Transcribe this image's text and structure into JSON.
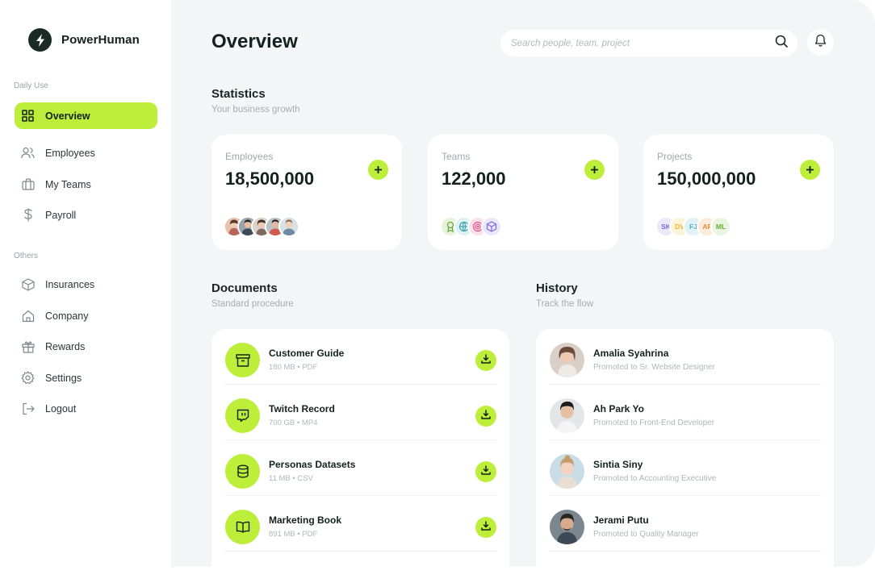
{
  "brand": {
    "name": "PowerHuman"
  },
  "sidebar": {
    "daily_label": "Daily Use",
    "others_label": "Others",
    "daily_items": [
      {
        "label": "Overview",
        "icon": "grid-icon",
        "active": true
      },
      {
        "label": "Employees",
        "icon": "users-icon"
      },
      {
        "label": "My Teams",
        "icon": "briefcase-icon"
      },
      {
        "label": "Payroll",
        "icon": "dollar-icon"
      }
    ],
    "other_items": [
      {
        "label": "Insurances",
        "icon": "box-icon"
      },
      {
        "label": "Company",
        "icon": "home-icon"
      },
      {
        "label": "Rewards",
        "icon": "gift-icon"
      },
      {
        "label": "Settings",
        "icon": "gear-icon"
      },
      {
        "label": "Logout",
        "icon": "logout-icon"
      }
    ]
  },
  "header": {
    "title": "Overview",
    "search_placeholder": "Search people, team, project"
  },
  "statistics": {
    "title": "Statistics",
    "subtitle": "Your business growth",
    "cards": [
      {
        "label": "Employees",
        "value": "18,500,000"
      },
      {
        "label": "Teams",
        "value": "122,000"
      },
      {
        "label": "Projects",
        "value": "150,000,000",
        "initials": [
          "SK",
          "DV",
          "FJ",
          "AF",
          "ML"
        ]
      }
    ]
  },
  "documents": {
    "title": "Documents",
    "subtitle": "Standard procedure",
    "items": [
      {
        "name": "Customer Guide",
        "meta": "180 MB • PDF",
        "icon": "archive-icon"
      },
      {
        "name": "Twitch Record",
        "meta": "700 GB • MP4",
        "icon": "twitch-icon"
      },
      {
        "name": "Personas Datasets",
        "meta": "11 MB • CSV",
        "icon": "database-icon"
      },
      {
        "name": "Marketing Book",
        "meta": "891 MB • PDF",
        "icon": "book-icon"
      }
    ]
  },
  "history": {
    "title": "History",
    "subtitle": "Track the flow",
    "items": [
      {
        "name": "Amalia Syahrina",
        "desc": "Promoted to Sr. Website Designer"
      },
      {
        "name": "Ah Park Yo",
        "desc": "Promoted to Front-End Developer"
      },
      {
        "name": "Sintia Siny",
        "desc": "Promoted to Accounting Executive"
      },
      {
        "name": "Jerami Putu",
        "desc": "Promoted to Quality Manager"
      }
    ]
  },
  "colors": {
    "accent": "#bdee3a",
    "dark": "#13221d",
    "background": "#f4f5f7"
  }
}
